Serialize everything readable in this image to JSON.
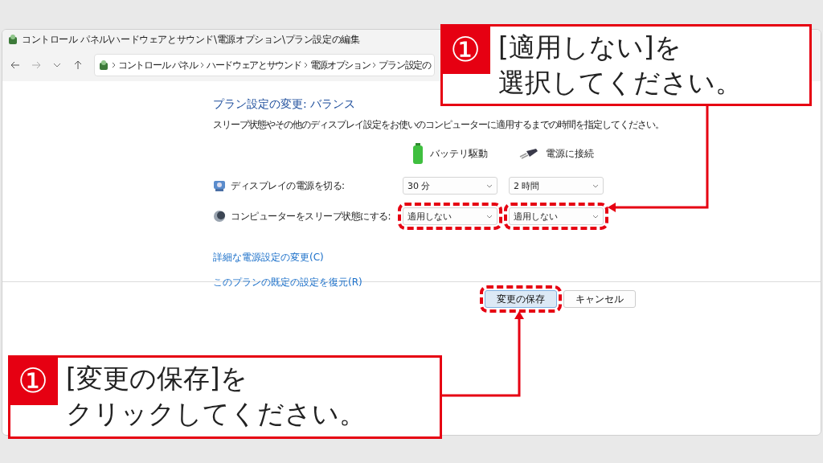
{
  "window": {
    "title": "コントロール パネル\\ハードウェアとサウンド\\電源オプション\\プラン設定の編集"
  },
  "address_bar": {
    "breadcrumbs": [
      "コントロール パネル",
      "ハードウェアとサウンド",
      "電源オプション",
      "プラン設定の"
    ]
  },
  "content": {
    "heading": "プラン設定の変更: バランス",
    "description": "スリープ状態やその他のディスプレイ設定をお使いのコンピューターに適用するまでの時間を指定してください。",
    "columns": [
      {
        "kind": "battery",
        "label": "バッテリ駆動"
      },
      {
        "kind": "plug",
        "label": "電源に接続"
      }
    ],
    "settings": [
      {
        "kind": "display",
        "label": "ディスプレイの電源を切る:",
        "values": [
          {
            "value": "30 分",
            "highlighted": false
          },
          {
            "value": "2 時間",
            "highlighted": false
          }
        ]
      },
      {
        "kind": "sleep",
        "label": "コンピューターをスリープ状態にする:",
        "values": [
          {
            "value": "適用しない",
            "highlighted": true
          },
          {
            "value": "適用しない",
            "highlighted": true
          }
        ]
      }
    ],
    "links": [
      "詳細な電源設定の変更(C)",
      "このプランの既定の設定を復元(R)"
    ]
  },
  "buttons": [
    {
      "label": "変更の保存",
      "highlighted": true,
      "kind": "primary"
    },
    {
      "label": "キャンセル",
      "highlighted": false,
      "kind": "normal"
    }
  ],
  "annotations": [
    {
      "number": "①",
      "lines": [
        "[適用しない]を",
        "選択してください。"
      ]
    },
    {
      "number": "①",
      "lines": [
        "[変更の保存]を",
        "クリックしてください。"
      ]
    }
  ]
}
